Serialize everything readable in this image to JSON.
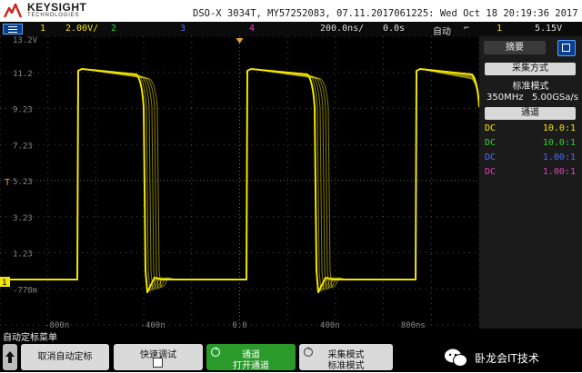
{
  "brand": {
    "name": "KEYSIGHT",
    "subtitle": "TECHNOLOGIES"
  },
  "header": {
    "model_line": "DSO-X 3034T, MY57252083, 07.11.2017061225: Wed Oct 18 20:19:36 2017"
  },
  "settings_bar": {
    "ch1_label": "1",
    "ch1_scale": "2.00V/",
    "ch2_label": "2",
    "ch3_label": "3",
    "ch4_label": "4",
    "timebase": "200.0ns/",
    "delay": "0.0s",
    "trigger_mode": "自动",
    "trigger_source": "1",
    "trigger_level": "5.15V"
  },
  "screen": {
    "y_ticks": [
      "13.2V",
      "11.2",
      "9.23",
      "7.23",
      "5.23",
      "3.23",
      "1.23",
      "-778m"
    ],
    "x_ticks": [
      "-800n",
      "-400n",
      "0.0",
      "400n",
      "800ns"
    ],
    "markers": {
      "ch1_marker": "1",
      "trigger_marker": "T"
    }
  },
  "panel": {
    "tab_summary": "摘要",
    "acquire_title": "采集方式",
    "acquire_mode": "标准模式",
    "bandwidth": "350MHz",
    "sample_rate": "5.00GSa/s",
    "channel_title": "通道",
    "channels": [
      {
        "coupling": "DC",
        "ratio": "10.0:1",
        "color": "#f2e600"
      },
      {
        "coupling": "DC",
        "ratio": "10.0:1",
        "color": "#2fd02f"
      },
      {
        "coupling": "DC",
        "ratio": "1.00:1",
        "color": "#4a6cff"
      },
      {
        "coupling": "DC",
        "ratio": "1.00:1",
        "color": "#e040c0"
      }
    ]
  },
  "softkeys": {
    "menu_title": "自动定标菜单",
    "back_icon": "arrow-up-icon",
    "cancel_autoscale": "取消自动定标",
    "fast_debug": "快速调试",
    "channels_line1": "通道",
    "channels_line2": "打开通道",
    "acquire_line1": "采集模式",
    "acquire_line2": "标准模式"
  },
  "watermark": {
    "text": "卧龙会IT技术"
  },
  "colors": {
    "ch1": "#f2e600",
    "ch2": "#2fd02f",
    "ch3": "#4a6cff",
    "ch4": "#e040c0",
    "trigger_orange": "#f0a020",
    "menu_blue": "#0a3f8c",
    "softkey_green": "#2a9a2a"
  }
}
